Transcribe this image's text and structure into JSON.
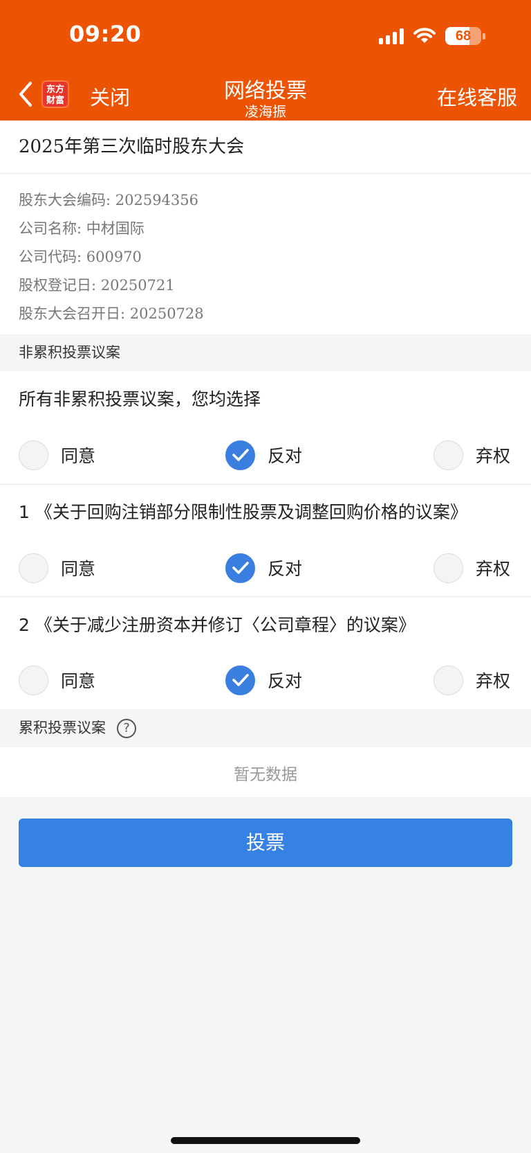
{
  "status_bar": {
    "time": "09:20",
    "battery": "68",
    "icons": [
      "signal-icon",
      "wifi-icon",
      "battery-icon"
    ]
  },
  "nav": {
    "back_icon": "chevron-left-icon",
    "logo_text_1": "东方",
    "logo_text_2": "财富",
    "close_label": "关闭",
    "title": "网络投票",
    "subtitle": "凌海振",
    "service_label": "在线客服"
  },
  "meeting": {
    "title": "2025年第三次临时股东大会",
    "info": [
      "股东大会编码: 202594356",
      "公司名称: 中材国际",
      "公司代码: 600970",
      "股权登记日: 20250721",
      "股东大会召开日: 20250728"
    ]
  },
  "non_cumulative": {
    "section_label": "非累积投票议案",
    "all_prompt": "所有非累积投票议案，您均选择",
    "options": [
      "同意",
      "反对",
      "弃权"
    ],
    "all_selected": "反对",
    "proposals": [
      {
        "text": "1 《关于回购注销部分限制性股票及调整回购价格的议案》",
        "selected": "反对"
      },
      {
        "text": "2 《关于减少注册资本并修订〈公司章程〉的议案》",
        "selected": "反对"
      }
    ]
  },
  "cumulative": {
    "section_label": "累积投票议案",
    "help_icon": "question-circle-icon",
    "help_symbol": "?",
    "empty_text": "暂无数据"
  },
  "vote_button_label": "投票",
  "colors": {
    "header_bg": "#ec5404",
    "accent": "#3582e4",
    "check": "#3a7fe0"
  }
}
